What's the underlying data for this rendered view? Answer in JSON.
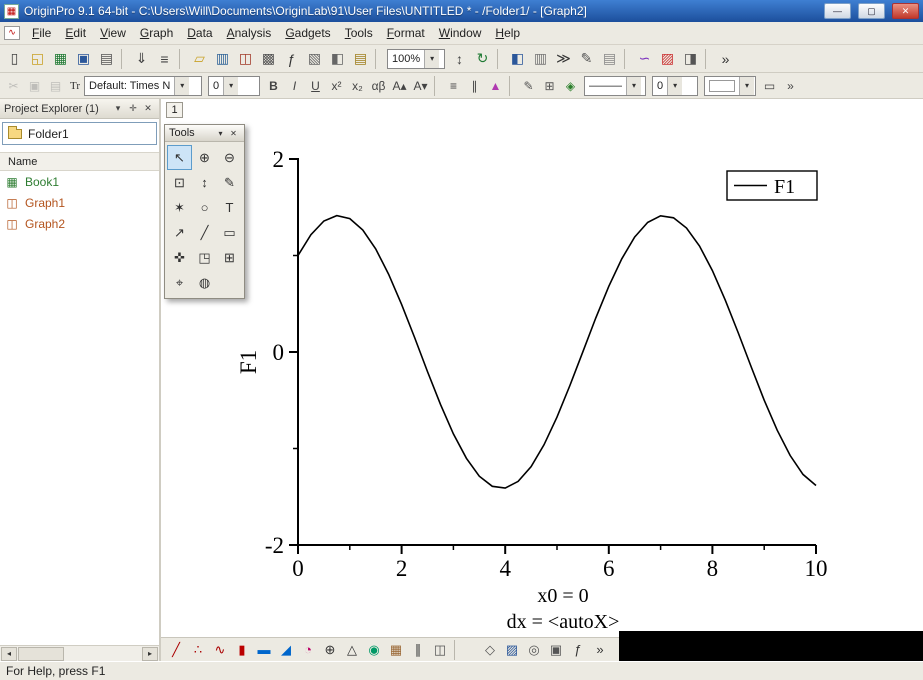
{
  "window": {
    "title": "OriginPro 9.1 64-bit - C:\\Users\\Will\\Documents\\OriginLab\\91\\User Files\\UNTITLED * - /Folder1/ - [Graph2]",
    "controls": {
      "minimize": "—",
      "maximize": "▢",
      "close": "✕"
    },
    "app_icon_glyph": "▦",
    "child_icon_glyph": "∿"
  },
  "menu": {
    "items": [
      "File",
      "Edit",
      "View",
      "Graph",
      "Data",
      "Analysis",
      "Gadgets",
      "Tools",
      "Format",
      "Window",
      "Help"
    ]
  },
  "toolbar_standard": {
    "items_left": [
      {
        "name": "new-project-button",
        "glyph": "▯",
        "tint": "#444"
      },
      {
        "name": "open-button",
        "glyph": "◱",
        "tint": "#c9a227"
      },
      {
        "name": "open-excel-button",
        "glyph": "▦",
        "tint": "#1f7a33"
      },
      {
        "name": "save-project-button",
        "glyph": "▣",
        "tint": "#2b579a"
      },
      {
        "name": "print-button",
        "glyph": "▤",
        "tint": "#555"
      },
      {
        "name": "separator",
        "glyph": "",
        "sep": true
      },
      {
        "name": "import-wizard-button",
        "glyph": "⇓",
        "tint": "#444"
      },
      {
        "name": "import-ascii-button",
        "glyph": "≡",
        "tint": "#444"
      },
      {
        "name": "separator",
        "glyph": "",
        "sep": true
      },
      {
        "name": "new-folder-button",
        "glyph": "▱",
        "tint": "#c9a227"
      },
      {
        "name": "new-workbook-button",
        "glyph": "▥",
        "tint": "#336699"
      },
      {
        "name": "new-graph-button",
        "glyph": "◫",
        "tint": "#a23b2a"
      },
      {
        "name": "new-matrix-button",
        "glyph": "▩",
        "tint": "#555"
      },
      {
        "name": "new-function-button",
        "glyph": "ƒ",
        "tint": "#333"
      },
      {
        "name": "new-3d-graph-button",
        "glyph": "▧",
        "tint": "#666"
      },
      {
        "name": "new-layout-button",
        "glyph": "◧",
        "tint": "#666"
      },
      {
        "name": "new-notes-button",
        "glyph": "▤",
        "tint": "#a08020"
      },
      {
        "name": "separator",
        "glyph": "",
        "sep": true
      }
    ],
    "zoom_value": "100%",
    "items_right": [
      {
        "name": "rescale-button",
        "glyph": "↕",
        "tint": "#444"
      },
      {
        "name": "refresh-button",
        "glyph": "↻",
        "tint": "#1f7a33"
      },
      {
        "name": "separator",
        "glyph": "",
        "sep": true
      },
      {
        "name": "project-explorer-toggle",
        "glyph": "◧",
        "tint": "#2b579a"
      },
      {
        "name": "results-log-button",
        "glyph": "▥",
        "tint": "#777"
      },
      {
        "name": "command-window-button",
        "glyph": "≫",
        "tint": "#333"
      },
      {
        "name": "code-builder-button",
        "glyph": "✎",
        "tint": "#555"
      },
      {
        "name": "script-window-button",
        "glyph": "▤",
        "tint": "#888"
      },
      {
        "name": "separator",
        "glyph": "",
        "sep": true
      },
      {
        "name": "fit-wizard-button",
        "glyph": "∽",
        "tint": "#7b2fbe"
      },
      {
        "name": "color-palette-button",
        "glyph": "▨",
        "tint": "#c33"
      },
      {
        "name": "add-color-scale-button",
        "glyph": "◨",
        "tint": "#555"
      },
      {
        "name": "separator",
        "glyph": "",
        "sep": true
      },
      {
        "name": "toolbar-options-button",
        "glyph": "»",
        "tint": "#333"
      }
    ]
  },
  "toolbar_format": {
    "icons_clipboard": [
      {
        "name": "cut-button",
        "glyph": "✂",
        "tint": "#888",
        "disabled": true
      },
      {
        "name": "copy-button",
        "glyph": "▣",
        "tint": "#888",
        "disabled": true
      },
      {
        "name": "paste-button",
        "glyph": "▤",
        "tint": "#888",
        "disabled": true
      }
    ],
    "font_badge": "Tr",
    "font_combo_value": "Default: Times N",
    "size_combo_value": "0",
    "icons_format": [
      {
        "name": "bold-button",
        "glyph": "B",
        "b": true
      },
      {
        "name": "italic-button",
        "glyph": "I",
        "i": true
      },
      {
        "name": "underline-button",
        "glyph": "U",
        "u": true
      },
      {
        "name": "superscript-button",
        "glyph": "x²"
      },
      {
        "name": "subscript-button",
        "glyph": "x₂"
      },
      {
        "name": "greek-button",
        "glyph": "αβ"
      },
      {
        "name": "increase-font-button",
        "glyph": "A▴"
      },
      {
        "name": "decrease-font-button",
        "glyph": "A▾"
      },
      {
        "name": "separator",
        "glyph": "",
        "sep": true
      },
      {
        "name": "align-button",
        "glyph": "≡"
      },
      {
        "name": "distribute-button",
        "glyph": "∥"
      },
      {
        "name": "font-color-button",
        "glyph": "▲",
        "tint": "#b03ab0"
      },
      {
        "name": "separator",
        "glyph": "",
        "sep": true
      },
      {
        "name": "pencil-tool-button",
        "glyph": "✎",
        "tint": "#555"
      },
      {
        "name": "add-axes-button",
        "glyph": "⊞",
        "tint": "#555"
      },
      {
        "name": "style-brush-button",
        "glyph": "◈",
        "tint": "#2a7f2a"
      }
    ],
    "line_style_value": "———",
    "line_width_value": "0",
    "shape_button_glyph": "▭",
    "overflow_glyph": "»",
    "dropdown_glyph": "▾"
  },
  "project_explorer": {
    "header": "Project Explorer (1)",
    "header_buttons": [
      {
        "name": "panel-menu-button",
        "glyph": "▾"
      },
      {
        "name": "pin-button",
        "glyph": "✛"
      },
      {
        "name": "close-panel-button",
        "glyph": "✕"
      }
    ],
    "folder_label": "Folder1",
    "column_header": "Name",
    "items": [
      {
        "name": "tree-item-book1",
        "label": "Book1",
        "glyph": "▦",
        "tint": "#2e7d32"
      },
      {
        "name": "tree-item-graph1",
        "label": "Graph1",
        "glyph": "◫",
        "tint": "#b3541e"
      },
      {
        "name": "tree-item-graph2",
        "label": "Graph2",
        "glyph": "◫",
        "tint": "#b3541e"
      }
    ]
  },
  "tools_palette": {
    "title": "Tools",
    "title_buttons": [
      {
        "name": "palette-menu-button",
        "glyph": "▾"
      },
      {
        "name": "palette-close-button",
        "glyph": "✕"
      }
    ],
    "tools": [
      {
        "name": "pointer-tool",
        "glyph": "↖",
        "selected": true
      },
      {
        "name": "zoom-in-tool",
        "glyph": "⊕"
      },
      {
        "name": "zoom-out-tool",
        "glyph": "⊖"
      },
      {
        "name": "selection-on-active-plot-tool",
        "glyph": "⊡"
      },
      {
        "name": "move-data-tool",
        "glyph": "↕"
      },
      {
        "name": "draw-data-tool",
        "glyph": "✎"
      },
      {
        "name": "mask-points-tool",
        "glyph": "✶"
      },
      {
        "name": "unmask-points-tool",
        "glyph": "○"
      },
      {
        "name": "text-tool",
        "glyph": "T"
      },
      {
        "name": "arrow-tool",
        "glyph": "↗"
      },
      {
        "name": "line-tool",
        "glyph": "╱"
      },
      {
        "name": "rectangle-tool",
        "glyph": "▭"
      },
      {
        "name": "pan-tool",
        "glyph": "✜"
      },
      {
        "name": "insert-graph-tool",
        "glyph": "◳"
      },
      {
        "name": "insert-equation-tool",
        "glyph": "⊞"
      },
      {
        "name": "reader-tool",
        "glyph": "⌖"
      },
      {
        "name": "rotate-tool",
        "glyph": "◍"
      }
    ]
  },
  "workspace": {
    "page_tab": "1"
  },
  "plot_toolbar": {
    "items": [
      {
        "name": "line-plot-button",
        "glyph": "╱",
        "tint": "#a00"
      },
      {
        "name": "scatter-plot-button",
        "glyph": "∴",
        "tint": "#a00"
      },
      {
        "name": "line-symbol-plot-button",
        "glyph": "∿",
        "tint": "#a00"
      },
      {
        "name": "column-plot-button",
        "glyph": "▮",
        "tint": "#b00"
      },
      {
        "name": "bar-plot-button",
        "glyph": "▬",
        "tint": "#06c"
      },
      {
        "name": "area-plot-button",
        "glyph": "◢",
        "tint": "#06c"
      },
      {
        "name": "pie-chart-button",
        "glyph": "◔",
        "tint": "#b06"
      },
      {
        "name": "polar-plot-button",
        "glyph": "⊕",
        "tint": "#333"
      },
      {
        "name": "ternary-plot-button",
        "glyph": "△",
        "tint": "#333"
      },
      {
        "name": "bubble-plot-button",
        "glyph": "◉",
        "tint": "#096"
      },
      {
        "name": "color-map-plot-button",
        "glyph": "▦",
        "tint": "#963"
      },
      {
        "name": "stock-plot-button",
        "glyph": "∥",
        "tint": "#333"
      },
      {
        "name": "multi-axis-plot-button",
        "glyph": "◫",
        "tint": "#555"
      },
      {
        "name": "separator",
        "glyph": "",
        "sep": true
      },
      {
        "name": "3d-scatter-button",
        "glyph": "◇",
        "tint": "#555"
      },
      {
        "name": "3d-surface-button",
        "glyph": "▨",
        "tint": "#2b579a"
      },
      {
        "name": "contour-plot-button",
        "glyph": "◎",
        "tint": "#555"
      },
      {
        "name": "image-plot-button",
        "glyph": "▣",
        "tint": "#555"
      },
      {
        "name": "function-plot-button",
        "glyph": "ƒ",
        "tint": "#333"
      },
      {
        "name": "more-plots-button",
        "glyph": "»",
        "tint": "#333"
      }
    ]
  },
  "chart_data": {
    "type": "line",
    "title": "",
    "xlabel": "",
    "ylabel": "F1",
    "xlim": [
      0,
      10
    ],
    "ylim": [
      -2,
      2
    ],
    "x_ticks": [
      0,
      2,
      4,
      6,
      8,
      10
    ],
    "x_minor_ticks": [
      1,
      3,
      5,
      7,
      9
    ],
    "y_ticks": [
      2,
      0,
      -2
    ],
    "y_minor_ticks": [
      1,
      -1
    ],
    "grid": false,
    "legend": {
      "position": "top-right",
      "entries": [
        "F1"
      ]
    },
    "annotations": [
      "x0 = 0",
      "dx = <autoX>"
    ],
    "series": [
      {
        "name": "F1",
        "x": [
          0,
          0.25,
          0.5,
          0.75,
          1,
          1.25,
          1.5,
          1.75,
          2,
          2.25,
          2.5,
          2.75,
          3,
          3.25,
          3.5,
          3.75,
          4,
          4.25,
          4.5,
          4.75,
          5,
          5.25,
          5.5,
          5.75,
          6,
          6.25,
          6.5,
          6.75,
          7,
          7.25,
          7.5,
          7.75,
          8,
          8.25,
          8.5,
          8.75,
          9,
          9.25,
          9.5,
          9.75,
          10
        ],
        "y": [
          1.0,
          1.216,
          1.357,
          1.413,
          1.382,
          1.264,
          1.068,
          0.806,
          0.493,
          0.15,
          -0.203,
          -0.543,
          -0.849,
          -1.102,
          -1.287,
          -1.392,
          -1.41,
          -1.341,
          -1.188,
          -0.962,
          -0.675,
          -0.347,
          0.003,
          0.353,
          0.681,
          0.966,
          1.192,
          1.343,
          1.411,
          1.391,
          1.285,
          1.098,
          0.844,
          0.537,
          0.197,
          -0.156,
          -0.499,
          -0.81,
          -1.072,
          -1.268,
          -1.383
        ]
      }
    ]
  },
  "status_bar": {
    "text": "For Help, press F1"
  }
}
